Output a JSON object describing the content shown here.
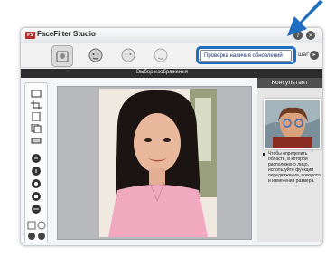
{
  "window": {
    "app_name": "FaceFilter Studio",
    "logo_text": "FS",
    "help_label": "?",
    "close_label": "×"
  },
  "toolbar": {
    "update_button_label": "Проверка наличия обновлений",
    "next_label": "шаг",
    "next_icon": "chevron-right-icon",
    "modes": [
      "image-select-icon",
      "face-detect-icon",
      "face-correct-icon",
      "face-print-icon"
    ]
  },
  "section": {
    "title": "Выбор изображения"
  },
  "advisor": {
    "header": "Консультант",
    "tip_text": "Чтобы определить область, в которой расположено лицо, используйте функции передвижения, поворота и изменения размера."
  },
  "left_tools": [
    "open-icon",
    "crop-icon",
    "page-icon",
    "copy-icon",
    "print-icon",
    "rotate-left-icon",
    "rotate-right-icon",
    "flip-icon",
    "red-eye-icon",
    "zoom-icon",
    "zoom-in-icon",
    "zoom-out-icon",
    "undo-icon",
    "redo-icon"
  ],
  "colors": {
    "highlight": "#1f6dbf",
    "dark_bar": "#2d2d2d",
    "canvas_bg": "#b7b9bc"
  }
}
